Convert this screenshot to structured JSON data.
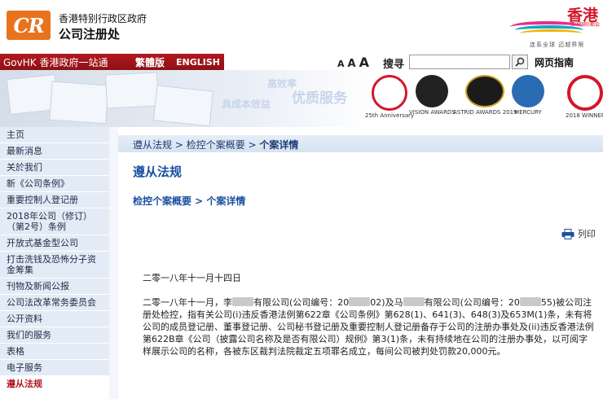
{
  "header": {
    "org_line1": "香港特别行政区政府",
    "org_line2": "公司注册处",
    "logo_text": "CR",
    "brand_text": "香港",
    "brand_sub": "亚洲国际都会",
    "slogan": "连系全球 迈越界限"
  },
  "gov_bar": {
    "govhk": "GovHK 香港政府一站通",
    "lang_trad": "繁體版",
    "lang_en": "ENGLISH",
    "font_small": "A",
    "font_medium": "A",
    "font_large": "A",
    "search_label": "搜寻",
    "search_value": "",
    "site_guide": "网页指南"
  },
  "banner": {
    "slogan1": "高效率",
    "slogan2": "具成本效益",
    "slogan3": "优质服务",
    "awards": [
      {
        "label": "25th Anniversary",
        "color": "#d5152b"
      },
      {
        "label": "VISION AWARDS",
        "color": "#222222"
      },
      {
        "label": "ASTRID AWARDS 2019",
        "color": "#b8860b"
      },
      {
        "label": "MERCURY",
        "color": "#2a6cb3"
      },
      {
        "label": "2018 WINNER",
        "color": "#d5152b"
      }
    ]
  },
  "nav": {
    "items": [
      "主页",
      "最新消息",
      "关於我们",
      "新《公司条例》",
      "重要控制人登记册",
      "2018年公司（修订）（第2号）条例",
      "开放式基金型公司",
      "打击洗钱及恐怖分子资金筹集",
      "刊物及新闻公报",
      "公司法改革常务委员会",
      "公开资料",
      "我们的服务",
      "表格",
      "电子服务",
      "遵从法规"
    ],
    "active_index": 14
  },
  "breadcrumb": {
    "item1": "遵从法规",
    "sep1": " > ",
    "item2": "检控个案概要",
    "sep2": " > ",
    "item3": "个案详情"
  },
  "content": {
    "title": "遵从法规",
    "subtitle": "检控个案概要 > 个案详情",
    "print_label": "列印",
    "date": "二零一八年十一月十四日",
    "p_1": "二零一八年十一月，李",
    "p_2": "有限公司(公司编号：20",
    "p_3": "02)及马",
    "p_4": "有限公司(公司编号：",
    "p_5": "20",
    "p_6": "55)被公司注册处检控，指有关公司(i)违反香港法例第622章《公司条例》第628(1)、641(3)、648(3)及653M(1)条，未有将公司的成员登记册、董事登记册、公司秘书登记册及重要控制人登记册备存于公司的注册办事处及(ii)违反香港法例第622B章《公司（披露公司名称及是否有限公司）规例》第3(1)条，未有持续地在公司的注册办事处，以可阅字样展示公司的名称，各被东区裁判法院裁定五项罪名成立，每间公司被判处罚款20,000元。"
  }
}
